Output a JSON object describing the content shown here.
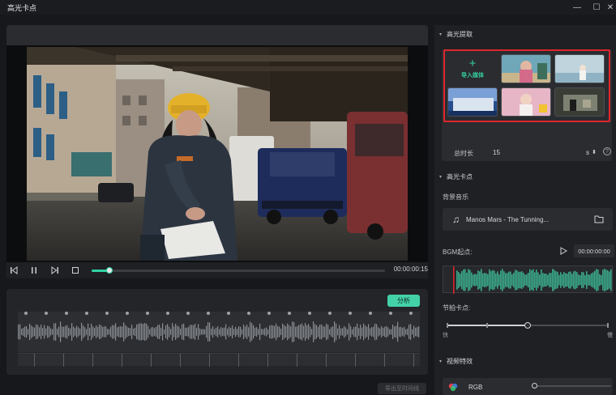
{
  "window": {
    "title": "高光卡点",
    "minimize": "—",
    "maximize": "☐",
    "close": "✕"
  },
  "player": {
    "timecode": "00:00:00:15",
    "progress": 0.06
  },
  "audio": {
    "analyze_label": "分析",
    "export_label": "导出至时间线"
  },
  "right": {
    "extract_title": "高光提取",
    "import_label": "导入媒体",
    "total_duration_label": "总时长",
    "total_duration_value": "15",
    "duration_unit": "s",
    "highlight_title": "高光卡点",
    "bgm_label": "背景音乐",
    "bgm_name": "Manos Mars - The Tunning...",
    "bgm_start_label": "BGM起点:",
    "bgm_start_time": "00:00:00:00",
    "beat_label": "节拍卡点:",
    "beat_level": 0.5,
    "speed_fast": "快",
    "speed_slow": "慢",
    "video_effect_title": "视频特效",
    "effect_name": "RGB"
  },
  "colors": {
    "accent": "#43d1a8",
    "highlight_border": "#e0262d",
    "wave_green": "#3aa88a"
  }
}
